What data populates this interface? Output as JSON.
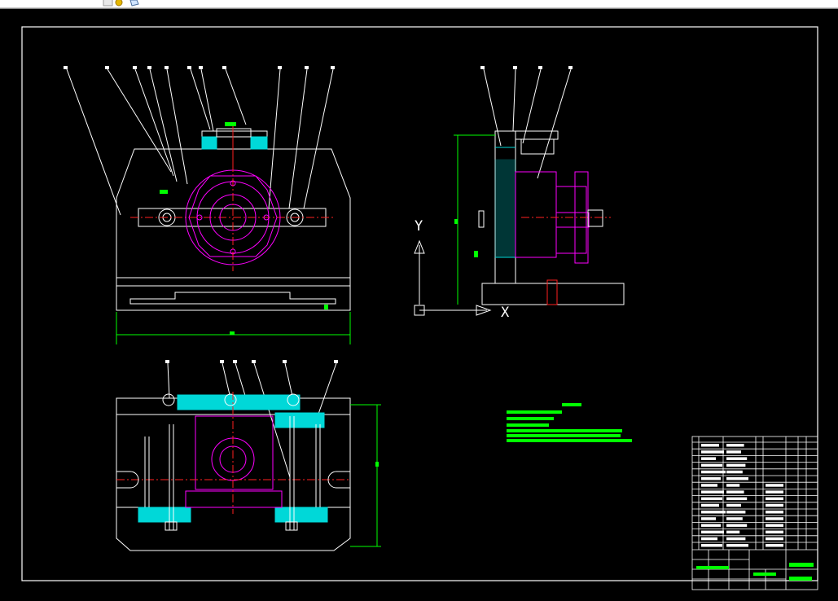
{
  "colors": {
    "background": "#000000",
    "outline": "#ffffff",
    "part_highlight": "#ff00ff",
    "section_fill": "#00d8d8",
    "annotation": "#00ff00",
    "centerline": "#ff2020",
    "dimension": "#00ff00"
  },
  "toolbar": {
    "icons": [
      "tool-icon-a",
      "tool-icon-b",
      "tool-icon-c"
    ]
  },
  "views": {
    "side_view": {
      "axis_y_label": "Y",
      "axis_x_label": "X"
    },
    "title_block": {
      "name_cell_label": "",
      "code_cell_label": ""
    }
  }
}
